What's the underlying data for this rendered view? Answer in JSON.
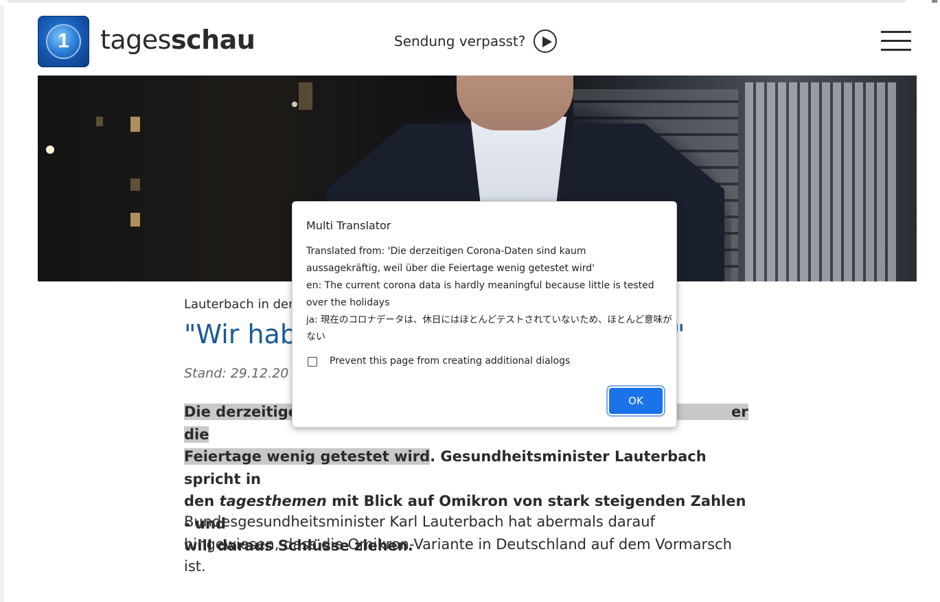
{
  "site": {
    "logo_text": "1",
    "wordmark_light": "tages",
    "wordmark_bold": "schau",
    "verpasst_label": "Sendung verpasst?"
  },
  "article": {
    "topline": "Lauterbach in den",
    "headline_start": "\"Wir hab",
    "headline_end": "\"",
    "stand": "Stand: 29.12.20",
    "teaser_line1_a": "Die derzeitigen",
    "teaser_line1_b": "er die",
    "teaser_line2_hl": "Feiertage wenig getestet wird",
    "teaser_line2_rest": ". Gesundheitsminister Lauterbach spricht in",
    "teaser_line3_a": "den ",
    "teaser_line3_italic": "tagesthemen",
    "teaser_line3_b": " mit Blick auf Omikron von stark steigenden Zahlen - und",
    "teaser_line4": "will daraus Schlüsse ziehen.",
    "body_line1": "Bundesgesundheitsminister Karl Lauterbach hat abermals darauf",
    "body_line2": "hingewiesen, dass die Omikron-Variante in Deutschland auf dem Vormarsch",
    "body_line3": "ist."
  },
  "dialog": {
    "title": "Multi Translator",
    "lines": [
      "Translated from: 'Die derzeitigen Corona-Daten sind kaum",
      "aussagekräftig, weil über die Feiertage wenig getestet wird'",
      "en: The current corona data is hardly meaningful because little is tested",
      "over the holidays",
      "ja: 現在のコロナデータは、休日にはほとんどテストされていないため、ほとんど意味が",
      "ない"
    ],
    "checkbox_label": "Prevent this page from creating additional dialogs",
    "checkbox_checked": false,
    "ok_label": "OK"
  },
  "colors": {
    "headline": "#1a5a96",
    "ok_button": "#1a73e8",
    "highlight": "#c8c8c8"
  },
  "icons": {
    "logo": "ard-1-globe-icon",
    "play": "play-circle-icon",
    "menu": "hamburger-menu-icon",
    "checkbox": "checkbox-icon"
  }
}
